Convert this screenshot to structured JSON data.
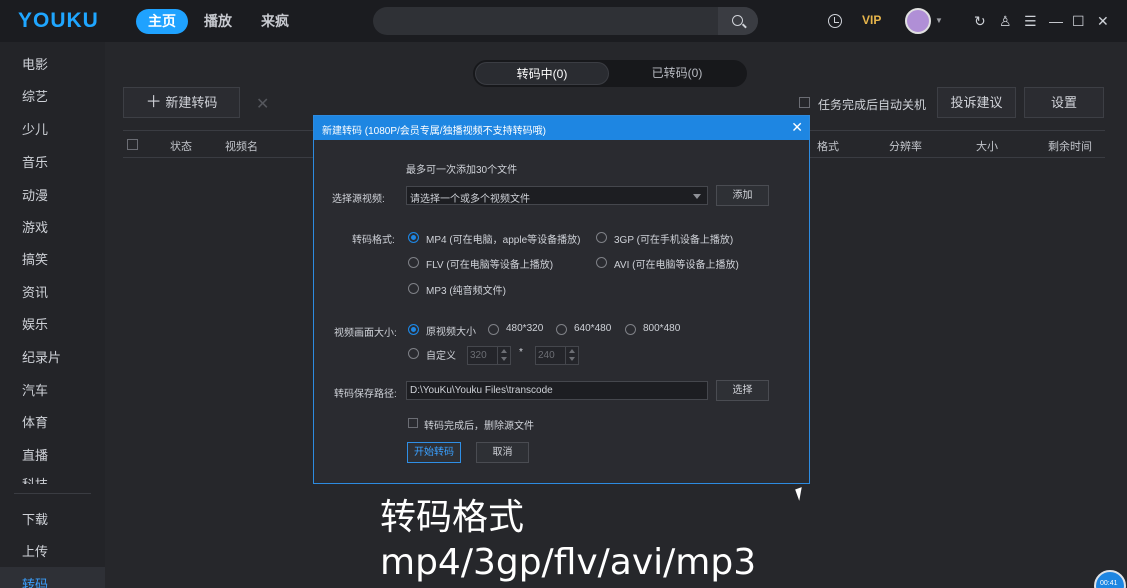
{
  "app": {
    "logo": "YOUKU",
    "nav": [
      "主页",
      "播放",
      "来疯"
    ],
    "vip": "VIP"
  },
  "sidebar": {
    "items": [
      "电影",
      "综艺",
      "少儿",
      "音乐",
      "动漫",
      "游戏",
      "搞笑",
      "资讯",
      "娱乐",
      "纪录片",
      "汽车",
      "体育",
      "直播",
      "科技"
    ],
    "bottom": [
      "下载",
      "上传",
      "转码"
    ]
  },
  "main": {
    "tabs": [
      "转码中(0)",
      "已转码(0)"
    ],
    "new_button": "新建转码",
    "auto_shutdown": "任务完成后自动关机",
    "feedback_button": "投诉建议",
    "settings_button": "设置",
    "columns_left": [
      "状态",
      "视频名"
    ],
    "columns_right": [
      "格式",
      "分辨率",
      "大小",
      "剩余时间"
    ]
  },
  "dialog": {
    "title": "新建转码 (1080P/会员专属/独播视频不支持转码哦)",
    "hint": "最多可一次添加30个文件",
    "source_label": "选择源视频:",
    "source_placeholder": "请选择一个或多个视频文件",
    "add_button": "添加",
    "format_label": "转码格式:",
    "formats": [
      {
        "label": "MP4 (可在电脑，apple等设备播放)",
        "selected": true
      },
      {
        "label": "3GP (可在手机设备上播放)",
        "selected": false
      },
      {
        "label": "FLV (可在电脑等设备上播放)",
        "selected": false
      },
      {
        "label": "AVI (可在电脑等设备上播放)",
        "selected": false
      },
      {
        "label": "MP3 (纯音频文件)",
        "selected": false
      }
    ],
    "size_label": "视频画面大小:",
    "sizes": [
      {
        "label": "原视频大小",
        "selected": true
      },
      {
        "label": "480*320",
        "selected": false
      },
      {
        "label": "640*480",
        "selected": false
      },
      {
        "label": "800*480",
        "selected": false
      }
    ],
    "custom_label": "自定义",
    "custom_width": "320",
    "custom_times": "*",
    "custom_height": "240",
    "path_label": "转码保存路径:",
    "path_value": "D:\\YouKu\\Youku Files\\transcode",
    "choose_button": "选择",
    "delete_source": "转码完成后，删除源文件",
    "start_button": "开始转码",
    "cancel_button": "取消"
  },
  "caption": {
    "line1": "转码格式",
    "line2": "mp4/3gp/flv/avi/mp3"
  },
  "corner_badge": "00:41",
  "colors": {
    "accent": "#1e86e2",
    "background": "#26272b",
    "vip": "#e7b54b"
  }
}
